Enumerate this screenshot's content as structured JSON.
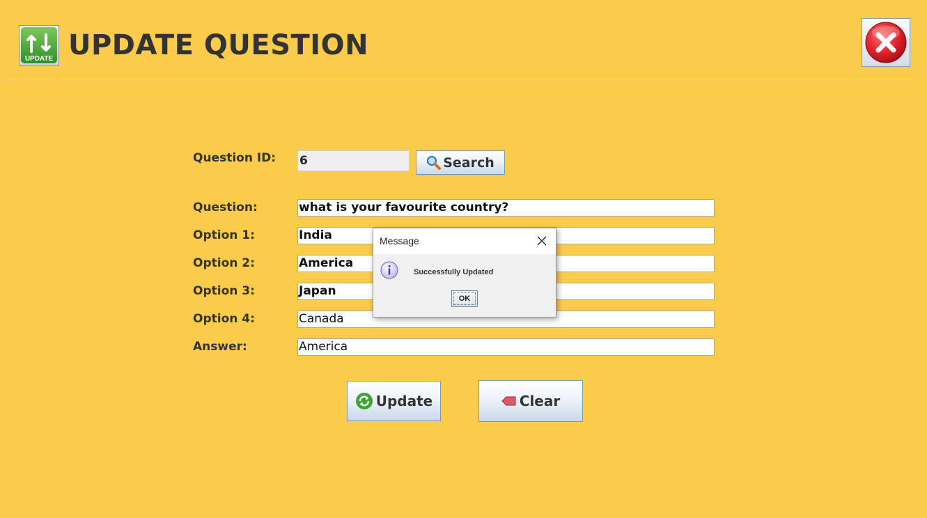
{
  "header": {
    "logo_text": "UPDATE",
    "title": "UPDATE QUESTION",
    "close_icon": "red-x-circle-icon"
  },
  "form": {
    "question_id_label": "Question ID:",
    "question_id_value": "6",
    "search_label": "Search",
    "question_label": "Question:",
    "question_value": "what is your favourite country?",
    "option1_label": "Option 1:",
    "option1_value": "India",
    "option2_label": "Option 2:",
    "option2_value": "America",
    "option3_label": "Option 3:",
    "option3_value": "Japan",
    "option4_label": "Option 4:",
    "option4_value": "Canada",
    "answer_label": "Answer:",
    "answer_value": "America",
    "update_label": "Update",
    "clear_label": "Clear"
  },
  "dialog": {
    "title": "Message",
    "message": "Successfully Updated",
    "ok_label": "OK"
  },
  "colors": {
    "background": "#FBCB4C",
    "title_text": "#333333",
    "close_red": "#E0202A"
  }
}
